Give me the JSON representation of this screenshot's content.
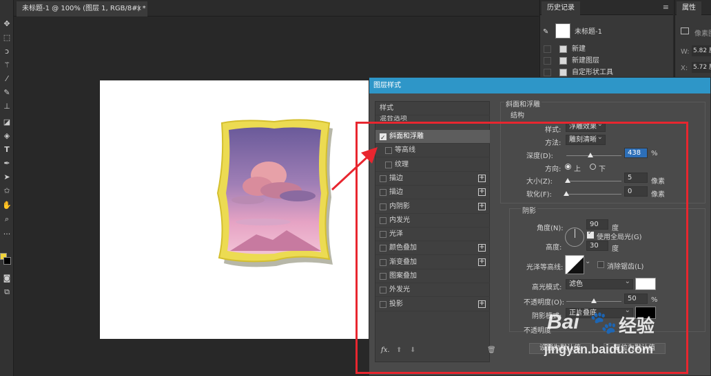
{
  "document": {
    "tab_label": "未标题-1 @ 100% (图层 1, RGB/8#) *",
    "close_glyph": "×"
  },
  "toolbar": {
    "tools": [
      "move-icon",
      "marquee-icon",
      "lasso-icon",
      "magic-wand-icon",
      "eyedropper-icon",
      "brush-icon",
      "stamp-icon",
      "eraser-icon",
      "paint-bucket-icon",
      "type-icon",
      "pen-icon",
      "path-select-icon",
      "custom-shape-icon",
      "hand-icon",
      "zoom-icon",
      "more-icon"
    ],
    "fg_color": "#f2d53a",
    "bg_color": "#000000"
  },
  "history": {
    "title": "历史记录",
    "snapshot_label": "未标题-1",
    "items": [
      "新建",
      "新建图层",
      "自定形状工具"
    ]
  },
  "properties": {
    "title": "属性",
    "subtitle": "像素图",
    "w_label": "W:",
    "w_value": "5.82 厘",
    "x_label": "X:",
    "x_value": "5.72 厘"
  },
  "dialog": {
    "title": "图层样式",
    "styles_header": "样式",
    "blend_options": "混合选项",
    "items": [
      {
        "label": "斜面和浮雕",
        "checked": true,
        "active": true,
        "plus": false,
        "indent": false
      },
      {
        "label": "等高线",
        "checked": false,
        "active": false,
        "plus": false,
        "indent": true
      },
      {
        "label": "纹理",
        "checked": false,
        "active": false,
        "plus": false,
        "indent": true
      },
      {
        "label": "描边",
        "checked": false,
        "active": false,
        "plus": true,
        "indent": false
      },
      {
        "label": "描边",
        "checked": false,
        "active": false,
        "plus": true,
        "indent": false
      },
      {
        "label": "内阴影",
        "checked": false,
        "active": false,
        "plus": true,
        "indent": false
      },
      {
        "label": "内发光",
        "checked": false,
        "active": false,
        "plus": false,
        "indent": false
      },
      {
        "label": "光泽",
        "checked": false,
        "active": false,
        "plus": false,
        "indent": false
      },
      {
        "label": "颜色叠加",
        "checked": false,
        "active": false,
        "plus": true,
        "indent": false
      },
      {
        "label": "渐变叠加",
        "checked": false,
        "active": false,
        "plus": true,
        "indent": false
      },
      {
        "label": "图案叠加",
        "checked": false,
        "active": false,
        "plus": false,
        "indent": false
      },
      {
        "label": "外发光",
        "checked": false,
        "active": false,
        "plus": false,
        "indent": false
      },
      {
        "label": "投影",
        "checked": false,
        "active": false,
        "plus": true,
        "indent": false
      }
    ],
    "fx_label": "fx.",
    "bevel": {
      "section_title": "斜面和浮雕",
      "structure_title": "结构",
      "style_label": "样式:",
      "style_value": "浮雕效果",
      "technique_label": "方法:",
      "technique_value": "雕刻清晰",
      "depth_label": "深度(D):",
      "depth_value": "438",
      "depth_unit": "%",
      "depth_fraction": 0.438,
      "direction_label": "方向:",
      "direction_up": "上",
      "direction_down": "下",
      "size_label": "大小(Z):",
      "size_value": "5",
      "size_unit": "像素",
      "size_fraction": 0.02,
      "soften_label": "软化(F):",
      "soften_value": "0",
      "soften_unit": "像素",
      "soften_fraction": 0.0
    },
    "shading": {
      "title": "阴影",
      "angle_label": "角度(N):",
      "angle_value": "90",
      "angle_unit": "度",
      "global_light_label": "使用全局光(G)",
      "global_light_checked": true,
      "altitude_label": "高度:",
      "altitude_value": "30",
      "altitude_unit": "度",
      "gloss_label": "光泽等高线:",
      "antialias_label": "消除锯齿(L)",
      "antialias_checked": false,
      "highlight_mode_label": "高光模式:",
      "highlight_mode_value": "滤色",
      "highlight_color": "#ffffff",
      "highlight_opacity_label": "不透明度(O):",
      "highlight_opacity_value": "50",
      "highlight_opacity_unit": "%",
      "highlight_opacity_fraction": 0.5,
      "shadow_mode_label": "阴影模式:",
      "shadow_mode_value": "正片叠底",
      "shadow_color": "#000000",
      "shadow_opacity_label": "不透明度",
      "reset_default_label": "设置为默认值",
      "restore_default_label": "复位为默认值"
    }
  },
  "annotation": {
    "box_color": "#e8262f"
  },
  "watermark": {
    "brand": "Bai",
    "brand_cn": "经验",
    "url": "jingyan.baidu.com"
  }
}
